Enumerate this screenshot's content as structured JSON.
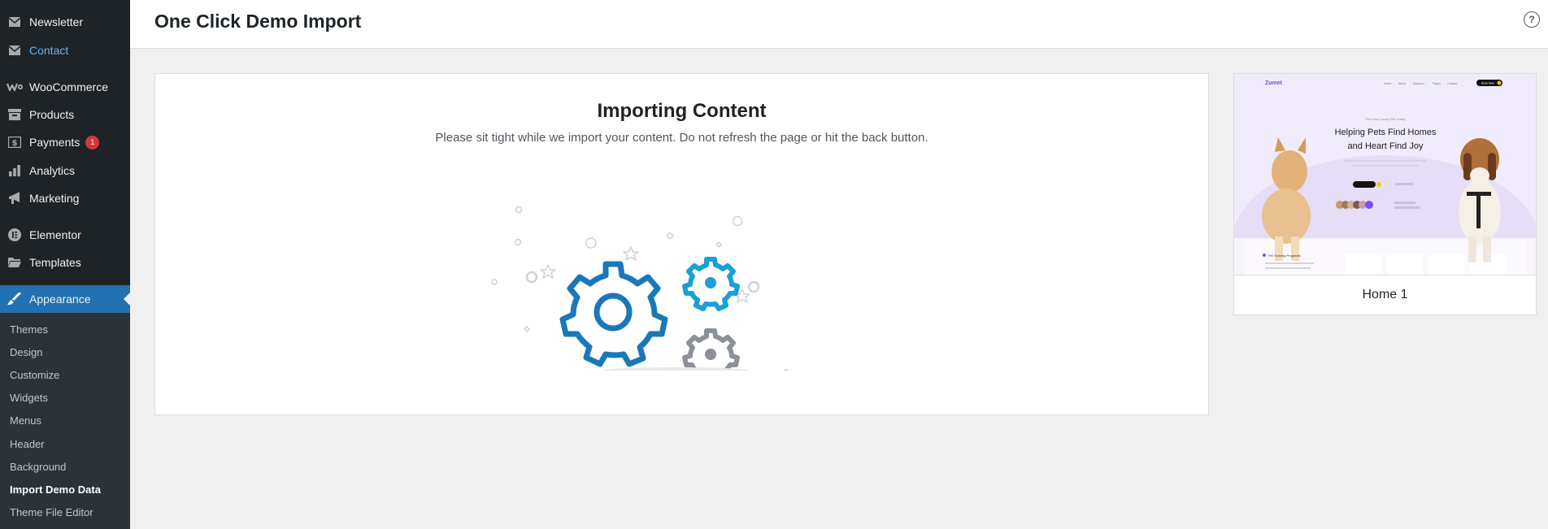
{
  "sidebar": {
    "items": [
      {
        "label": "Newsletter",
        "icon": "mail-icon"
      },
      {
        "label": "Contact",
        "icon": "mail-icon"
      },
      {
        "label": "WooCommerce",
        "icon": "woocommerce-icon"
      },
      {
        "label": "Products",
        "icon": "archive-icon"
      },
      {
        "label": "Payments",
        "icon": "dollar-icon",
        "badge": "1"
      },
      {
        "label": "Analytics",
        "icon": "bar-chart-icon"
      },
      {
        "label": "Marketing",
        "icon": "megaphone-icon"
      },
      {
        "label": "Elementor",
        "icon": "elementor-icon"
      },
      {
        "label": "Templates",
        "icon": "folder-icon"
      },
      {
        "label": "Appearance",
        "icon": "paintbrush-icon"
      }
    ],
    "submenu": [
      "Themes",
      "Design",
      "Customize",
      "Widgets",
      "Menus",
      "Header",
      "Background",
      "Import Demo Data",
      "Theme File Editor"
    ],
    "active_submenu": "Import Demo Data"
  },
  "header": {
    "title": "One Click Demo Import",
    "help_icon": "help-icon",
    "help_glyph": "?"
  },
  "import": {
    "title": "Importing Content",
    "description": "Please sit tight while we import your content. Do not refresh the page or hit the back button."
  },
  "demo": {
    "name": "Home 1",
    "preview": {
      "logo": "Zumet",
      "nav": [
        "Home",
        "About",
        "Adoption",
        "Pages",
        "Contact"
      ],
      "nav_button": "Book Now",
      "tagline": "Find Your Lovely Pet Today",
      "headline_1": "Helping Pets Find Homes",
      "headline_2": "and Heart Find Joy",
      "section_title": "Pet Training Programs"
    }
  },
  "colors": {
    "sidebar_bg": "#1d2327",
    "accent": "#2271b1",
    "gear_blue": "#1978b8",
    "gear_light_blue": "#1aa0d8",
    "gear_gray": "#8c9197",
    "badge": "#d63638"
  }
}
